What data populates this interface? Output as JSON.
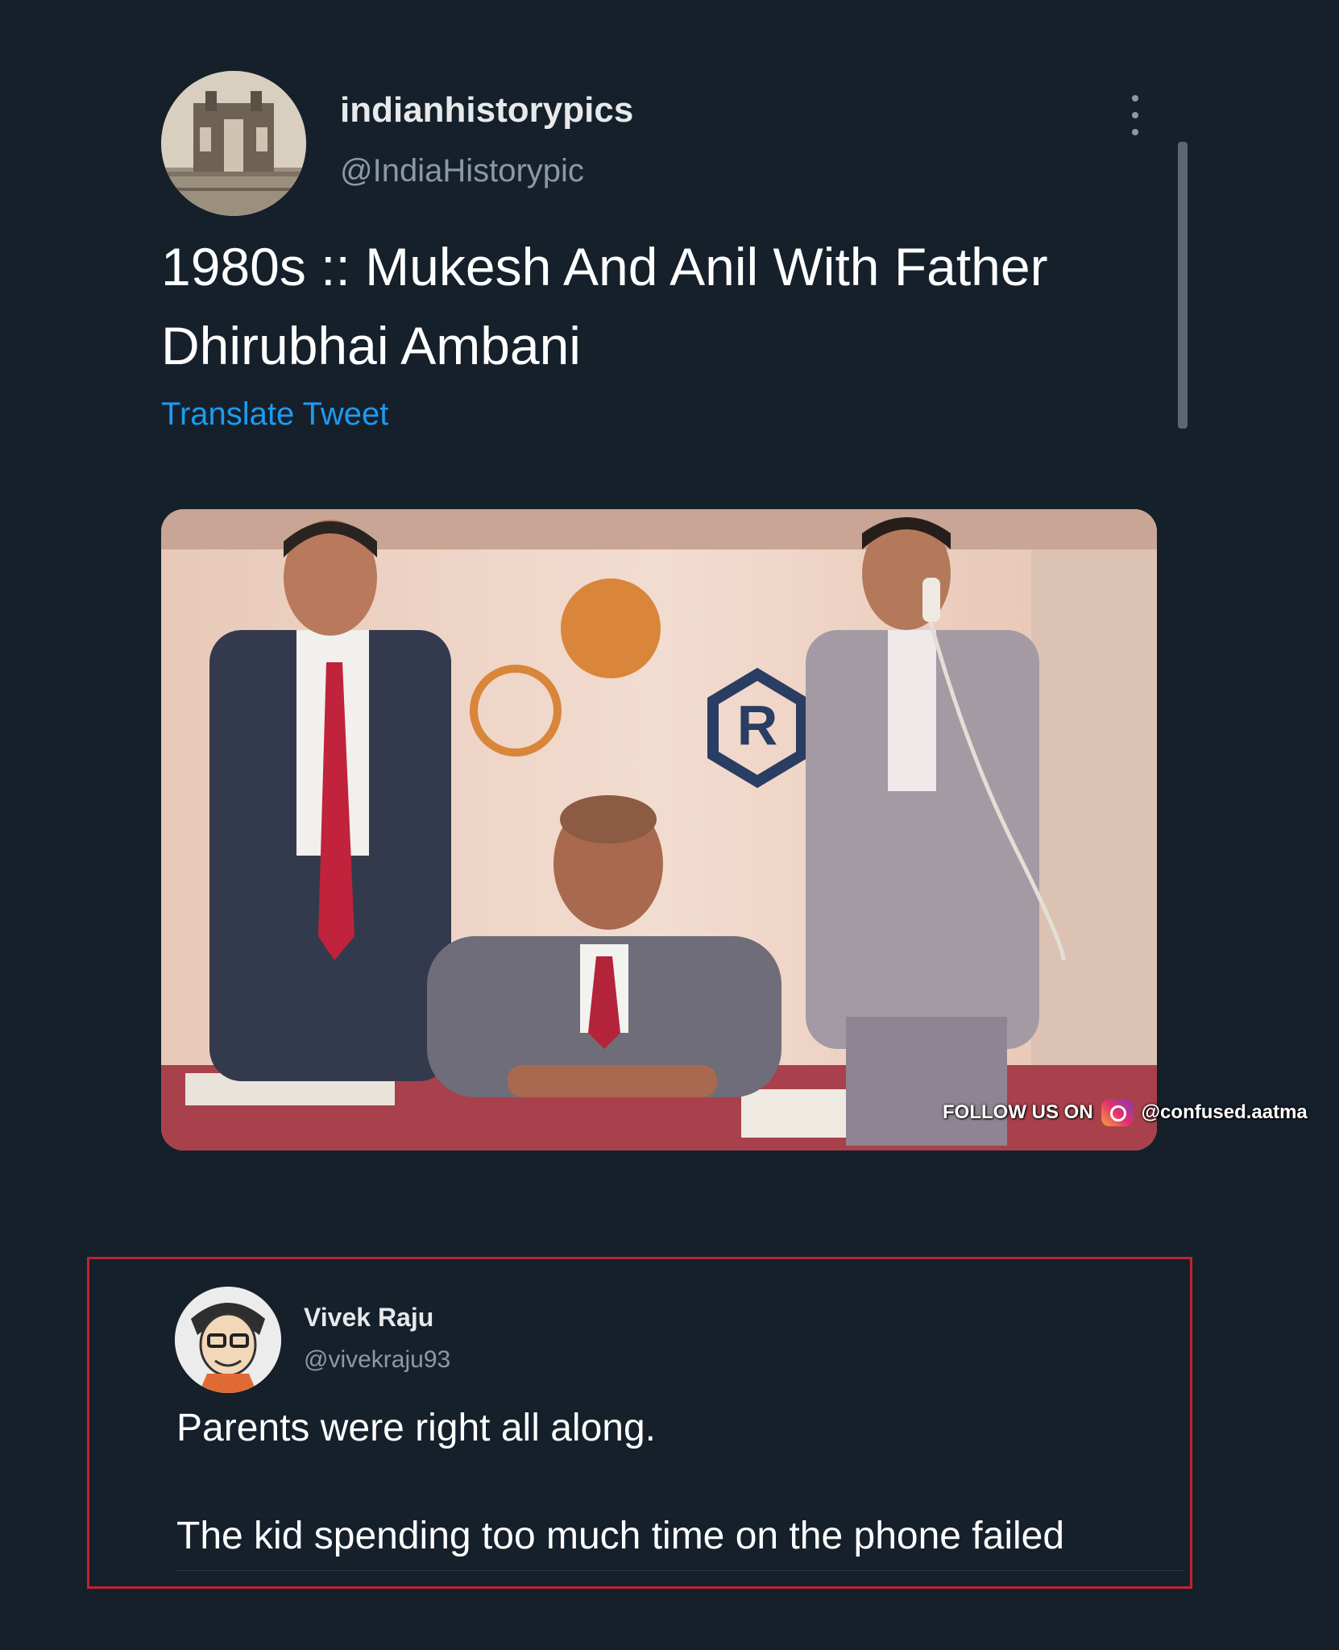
{
  "tweet": {
    "author_name": "indianhistorypics",
    "author_handle": "@IndiaHistorypic",
    "text_line1": "1980s :: Mukesh And Anil With Father",
    "text_line2": "Dhirubhai Ambani",
    "translate_label": "Translate Tweet",
    "avatar_icon": "gateway-of-india-photo",
    "more_icon": "more-vertical-icon",
    "image": {
      "description_icon": "photo",
      "watermark_prefix": "FOLLOW US ON",
      "watermark_handle": "@confused.aatma",
      "watermark_icon": "instagram-icon"
    }
  },
  "reply": {
    "author_name": "Vivek Raju",
    "author_handle": "@vivekraju93",
    "text_line1": "Parents were right all along.",
    "text_line2": "The kid spending too much time on the phone failed",
    "avatar_icon": "cartoon-avatar",
    "highlight_color": "#c0242e"
  },
  "colors": {
    "background": "#15202b",
    "link": "#1d9bf0",
    "secondary_text": "#8b98a5"
  }
}
